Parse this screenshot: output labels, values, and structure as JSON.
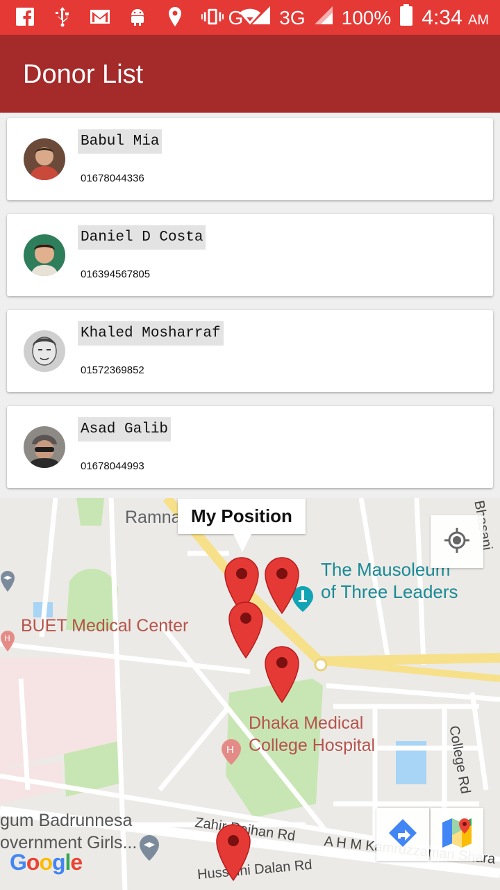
{
  "status_bar": {
    "network_g": "G",
    "network_3g": "3G",
    "battery": "100%",
    "time": "4:34",
    "ampm": "AM"
  },
  "app_bar": {
    "title": "Donor List"
  },
  "donors": [
    {
      "name": "Babul Mia",
      "phone": "01678044336"
    },
    {
      "name": "Daniel D Costa",
      "phone": "016394567805"
    },
    {
      "name": "Khaled Mosharraf",
      "phone": "01572369852"
    },
    {
      "name": "Asad Galib",
      "phone": "01678044993"
    }
  ],
  "map": {
    "info_window": "My Position",
    "labels": {
      "ramna": "Ramna",
      "mausoleum_1": "The Mausoleum",
      "mausoleum_2": "of Three Leaders",
      "buet": "BUET Medical Center",
      "dmch_1": "Dhaka Medical",
      "dmch_2": "College Hospital",
      "college_road": "College Rd",
      "badrunnesa_1": "gum Badrunnesa",
      "badrunnesa_2": "overnment Girls...",
      "zahir_rd": "Zahir Raihan Rd",
      "ahm_rd": "A H M Kamruzzaman Shara",
      "hussaini_rd": "Hussaini Dalan Rd",
      "bhasani": "Bhasani"
    },
    "google_logo": "Google",
    "marker_count": 5
  },
  "colors": {
    "status_bar": "#e53935",
    "app_bar": "#a52a2a",
    "marker": "#e53935"
  }
}
